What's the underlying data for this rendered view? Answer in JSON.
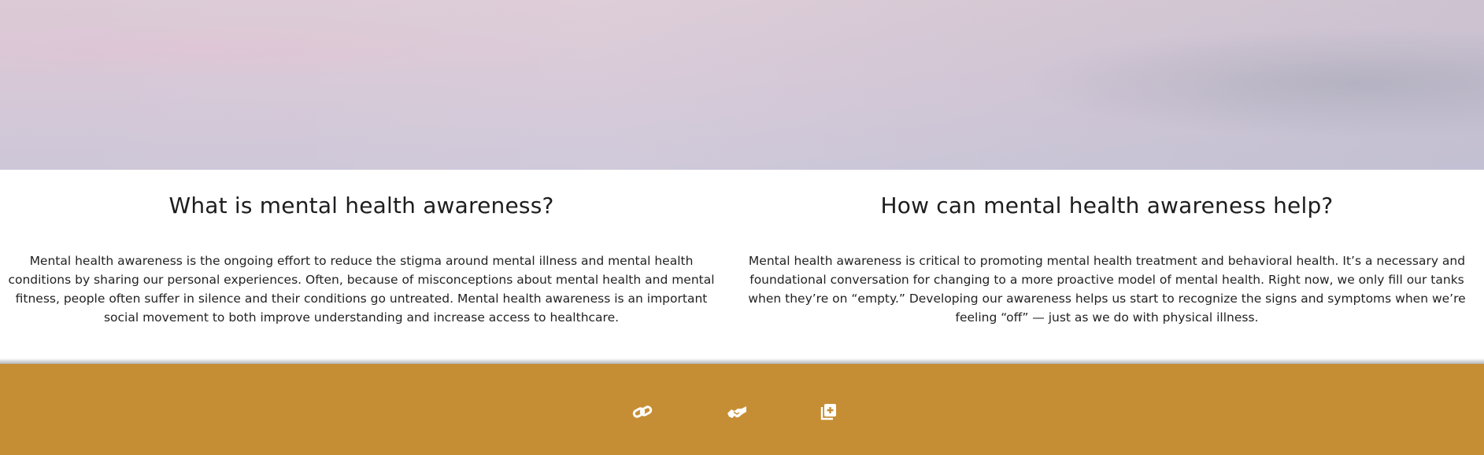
{
  "sections": [
    {
      "title": "What is mental health awareness?",
      "body": "Mental health awareness is the ongoing effort to reduce the stigma around mental illness and mental health conditions by sharing our personal experiences. Often, because of misconceptions about mental health and mental fitness, people often suffer in silence and their conditions go untreated. Mental health awareness is an important social movement to both improve understanding and increase access to healthcare."
    },
    {
      "title": "How can mental health awareness help?",
      "body": "Mental health awareness is critical to promoting mental health treatment and behavioral health. It’s a necessary and foundational conversation for changing to a more proactive model of mental health. Right now, we only fill our tanks when they’re on “empty.” Developing our awareness helps us start to recognize the signs and symptoms when we’re feeling “off” — just as we do with physical illness."
    }
  ],
  "footer": {
    "icons": [
      "link-icon",
      "handshake-icon",
      "add-document-icon"
    ]
  },
  "colors": {
    "footer_background": "#c68e34",
    "icon_color": "#ffffff",
    "text": "#222222"
  }
}
